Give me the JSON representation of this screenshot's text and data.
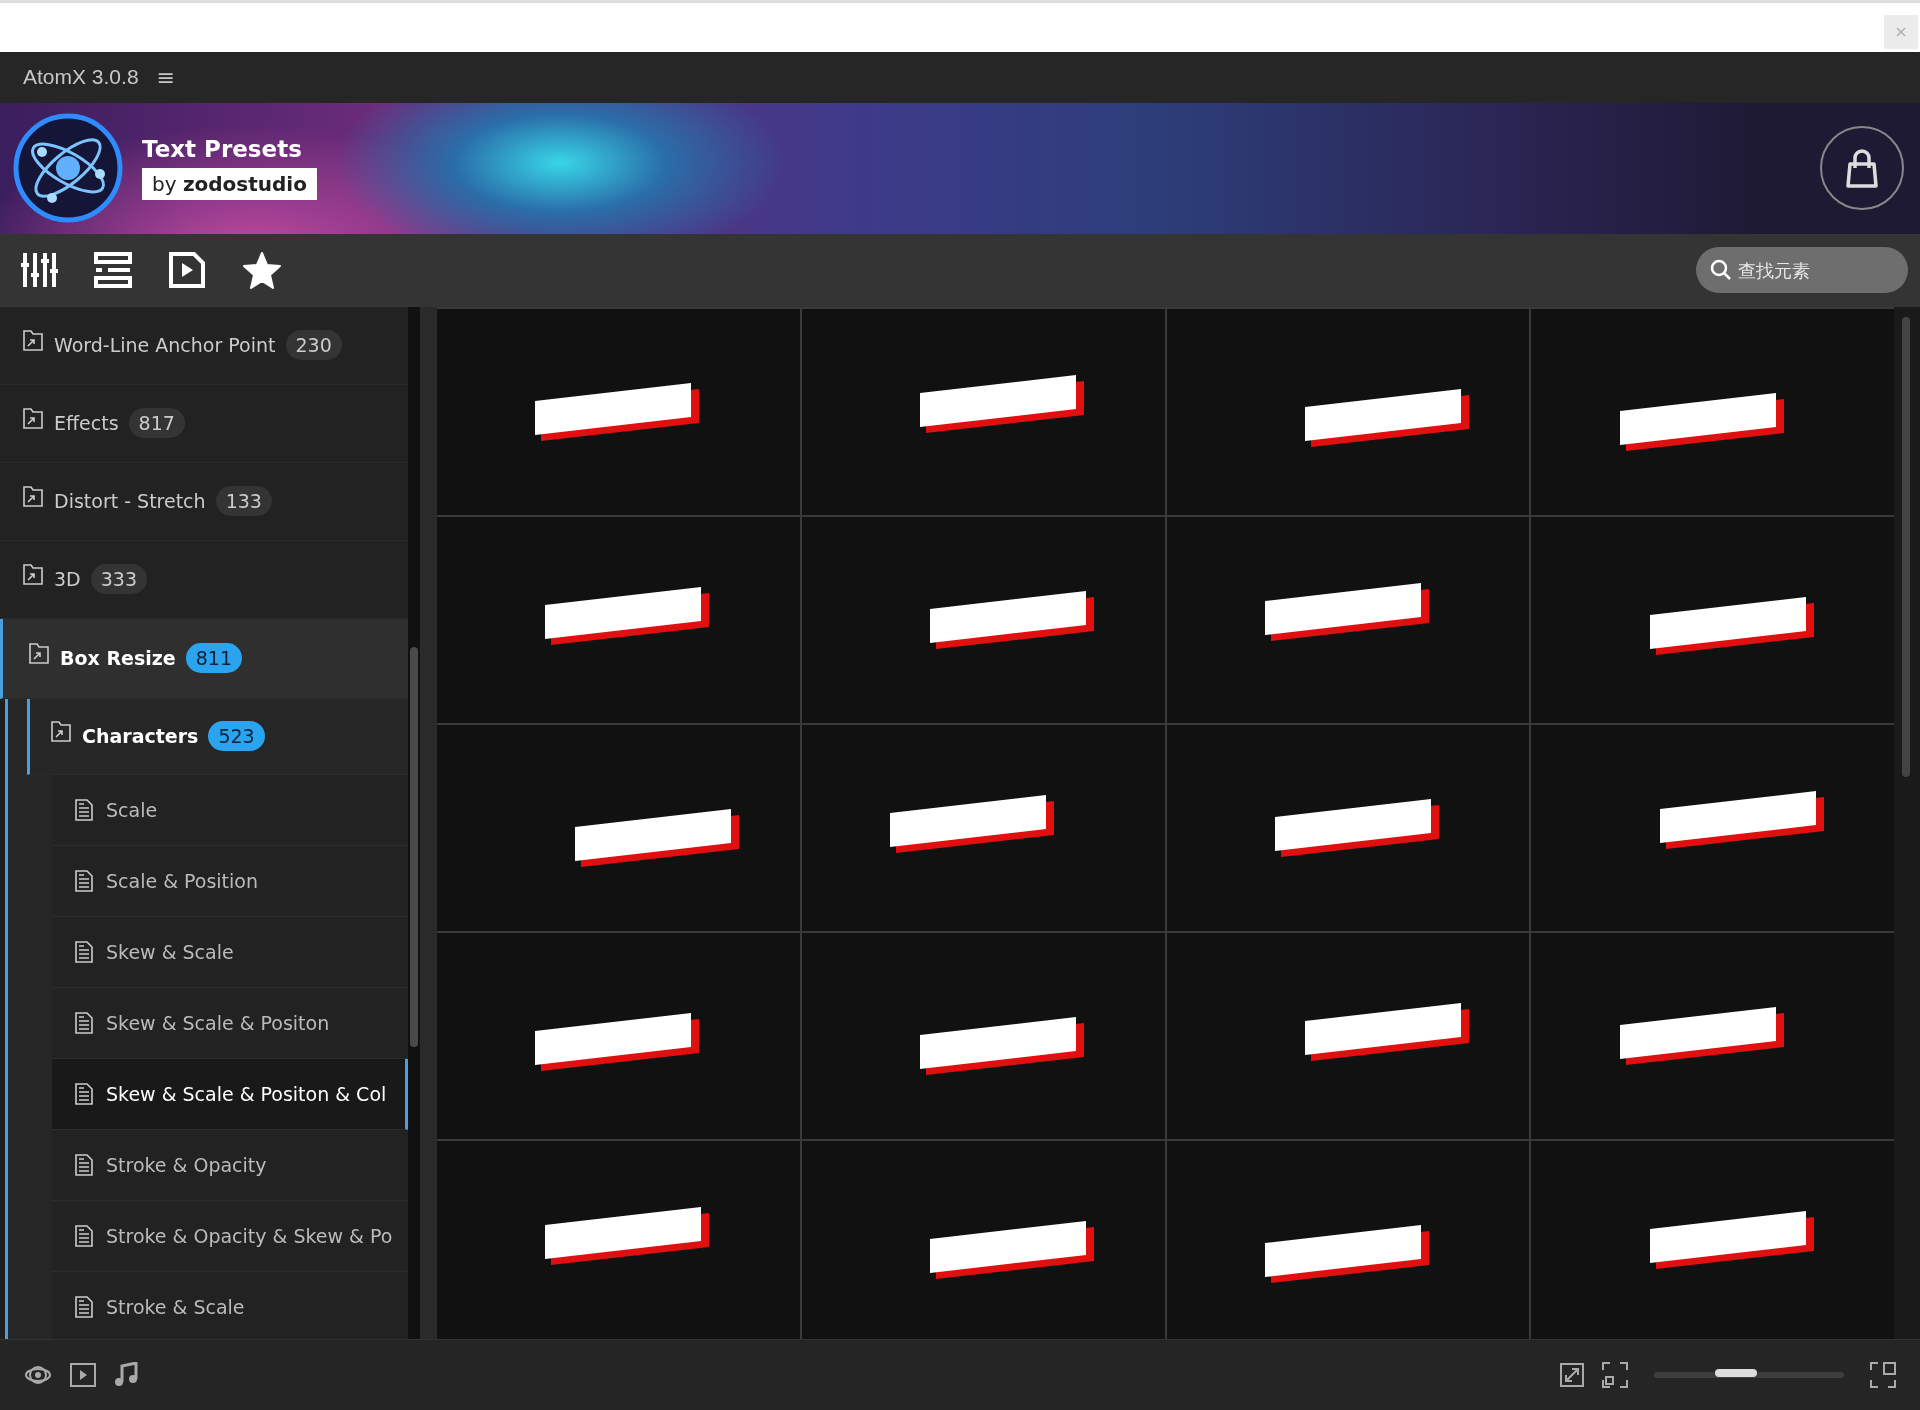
{
  "app": {
    "title": "AtomX 3.0.8",
    "menu_icon": "≡"
  },
  "banner": {
    "title": "Text Presets",
    "byline": "by **zodostudio**"
  },
  "search": {
    "placeholder": "查找元素"
  },
  "toolbar": {
    "tabs": [
      {
        "kind": "sliders",
        "selected": false
      },
      {
        "kind": "list",
        "selected": false
      },
      {
        "kind": "preview",
        "selected": false
      },
      {
        "kind": "star",
        "selected": false
      }
    ]
  },
  "sidebar": {
    "items": [
      {
        "label": "Word-Line Anchor Point",
        "count": "230",
        "expanded": false
      },
      {
        "label": "Effects",
        "count": "817",
        "expanded": false
      },
      {
        "label": "Distort - Stretch",
        "count": "133",
        "expanded": false
      },
      {
        "label": "3D",
        "count": "333",
        "expanded": false
      },
      {
        "label": "Box Resize",
        "count": "811",
        "expanded": true,
        "children": [
          {
            "label": "Characters",
            "count": "523",
            "expanded": true,
            "children": [
              {
                "label": "Scale",
                "selected": false
              },
              {
                "label": "Scale & Position",
                "selected": false
              },
              {
                "label": "Skew & Scale",
                "selected": false
              },
              {
                "label": "Skew & Scale & Positon",
                "selected": false
              },
              {
                "label": "Skew & Scale & Positon & Col",
                "selected": true
              },
              {
                "label": "Stroke & Opacity",
                "selected": false
              },
              {
                "label": "Stroke & Opacity & Skew & Po",
                "selected": false
              },
              {
                "label": "Stroke & Scale",
                "selected": false
              }
            ]
          }
        ]
      }
    ]
  },
  "footer": {
    "zoom": {
      "level": 0.43
    }
  }
}
